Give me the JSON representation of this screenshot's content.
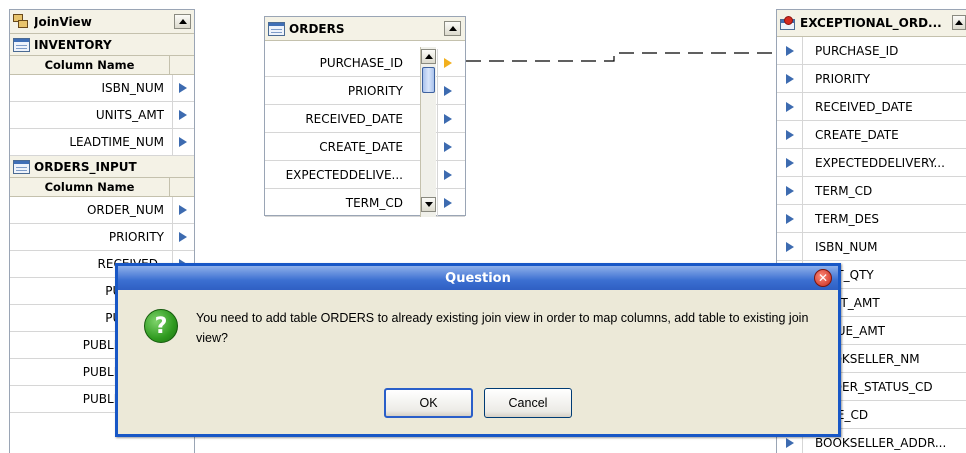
{
  "joinview": {
    "title": "JoinView",
    "inventory": {
      "title": "INVENTORY",
      "column_header": "Column Name",
      "rows": [
        "ISBN_NUM",
        "UNITS_AMT",
        "LEADTIME_NUM"
      ]
    },
    "orders_input": {
      "title": "ORDERS_INPUT",
      "column_header": "Column Name",
      "rows": [
        "ORDER_NUM",
        "PRIORITY",
        "RECEIVED_",
        "PUBLISHE",
        "PUBLISHE",
        "PUBLISHER_A",
        "PUBLISHER_A",
        "PUBLISHER_A"
      ]
    }
  },
  "orders": {
    "title": "ORDERS",
    "rows": [
      "PURCHASE_ID",
      "PRIORITY",
      "RECEIVED_DATE",
      "CREATE_DATE",
      "EXPECTEDDELIVE...",
      "TERM_CD"
    ]
  },
  "exceptional": {
    "title": "EXCEPTIONAL_ORD...",
    "rows": [
      "PURCHASE_ID",
      "PRIORITY",
      "RECEIVED_DATE",
      "CREATE_DATE",
      "EXPECTEDDELIVERY...",
      "TERM_CD",
      "TERM_DES",
      "ISBN_NUM",
      "UNIT_QTY",
      "COST_AMT",
      "VALUE_AMT",
      "BOOKSELLER_NM",
      "ORDER_STATUS_CD",
      "TYPE_CD",
      "BOOKSELLER_ADDR..."
    ]
  },
  "dialog": {
    "title": "Question",
    "message": "You need to add table ORDERS to already existing join view in order to map columns, add table to existing join view?",
    "ok_label": "OK",
    "cancel_label": "Cancel",
    "close_glyph": "✕",
    "icon_glyph": "?"
  },
  "colors": {
    "link_arrow": "#3d6bb0",
    "selected_arrow": "#f2b01e",
    "dialog_title": "#2f5fc3"
  }
}
